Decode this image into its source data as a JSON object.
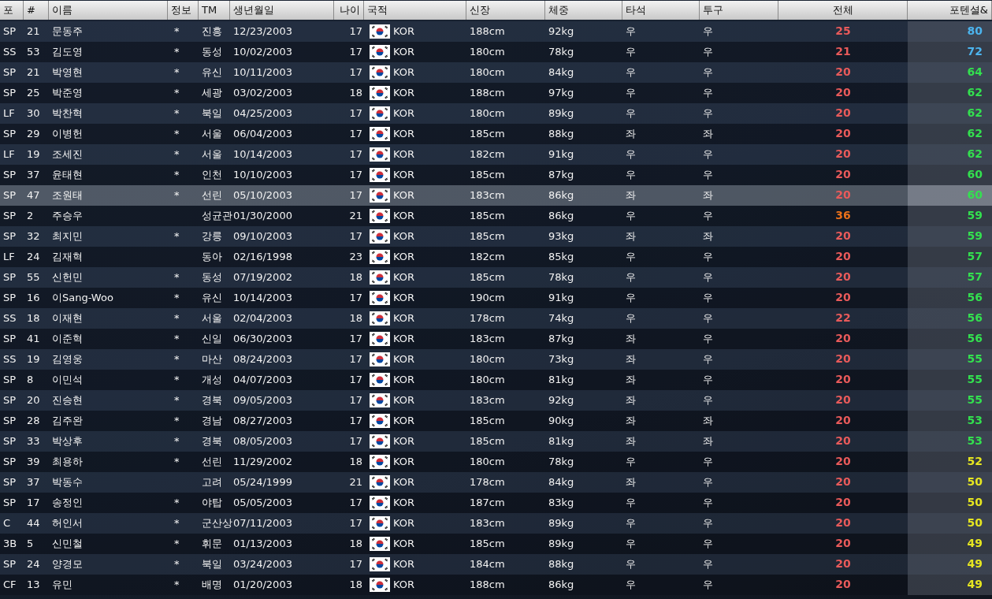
{
  "columns": [
    "포",
    "#",
    "이름",
    "정보",
    "TM",
    "생년월일",
    "나이",
    "국적",
    "신장",
    "체중",
    "타석",
    "투구",
    "전체",
    "포텐셜&"
  ],
  "rows": [
    {
      "pos": "SP",
      "no": "21",
      "name": "문동주",
      "info": "*",
      "tm": "진흥",
      "birth": "12/23/2003",
      "age": "17",
      "nation": "KOR",
      "height": "188cm",
      "weight": "92kg",
      "bat": "우",
      "throw": "우",
      "overall": {
        "value": "25",
        "color": "#e85a5a"
      },
      "potential": {
        "value": "80",
        "color": "#4cb4ee"
      },
      "selected": false
    },
    {
      "pos": "SS",
      "no": "53",
      "name": "김도영",
      "info": "*",
      "tm": "동성",
      "birth": "10/02/2003",
      "age": "17",
      "nation": "KOR",
      "height": "180cm",
      "weight": "78kg",
      "bat": "우",
      "throw": "우",
      "overall": {
        "value": "21",
        "color": "#e85a5a"
      },
      "potential": {
        "value": "72",
        "color": "#4cb4ee"
      },
      "selected": false
    },
    {
      "pos": "SP",
      "no": "21",
      "name": "박영현",
      "info": "*",
      "tm": "유신",
      "birth": "10/11/2003",
      "age": "17",
      "nation": "KOR",
      "height": "180cm",
      "weight": "84kg",
      "bat": "우",
      "throw": "우",
      "overall": {
        "value": "20",
        "color": "#e85a5a"
      },
      "potential": {
        "value": "64",
        "color": "#33e04f"
      },
      "selected": false
    },
    {
      "pos": "SP",
      "no": "25",
      "name": "박준영",
      "info": "*",
      "tm": "세광",
      "birth": "03/02/2003",
      "age": "18",
      "nation": "KOR",
      "height": "188cm",
      "weight": "97kg",
      "bat": "우",
      "throw": "우",
      "overall": {
        "value": "20",
        "color": "#e85a5a"
      },
      "potential": {
        "value": "62",
        "color": "#33e04f"
      },
      "selected": false
    },
    {
      "pos": "LF",
      "no": "30",
      "name": "박찬혁",
      "info": "*",
      "tm": "북일",
      "birth": "04/25/2003",
      "age": "17",
      "nation": "KOR",
      "height": "180cm",
      "weight": "89kg",
      "bat": "우",
      "throw": "우",
      "overall": {
        "value": "20",
        "color": "#e85a5a"
      },
      "potential": {
        "value": "62",
        "color": "#33e04f"
      },
      "selected": false
    },
    {
      "pos": "SP",
      "no": "29",
      "name": "이병헌",
      "info": "*",
      "tm": "서울",
      "birth": "06/04/2003",
      "age": "17",
      "nation": "KOR",
      "height": "185cm",
      "weight": "88kg",
      "bat": "좌",
      "throw": "좌",
      "overall": {
        "value": "20",
        "color": "#e85a5a"
      },
      "potential": {
        "value": "62",
        "color": "#33e04f"
      },
      "selected": false
    },
    {
      "pos": "LF",
      "no": "19",
      "name": "조세진",
      "info": "*",
      "tm": "서울",
      "birth": "10/14/2003",
      "age": "17",
      "nation": "KOR",
      "height": "182cm",
      "weight": "91kg",
      "bat": "우",
      "throw": "우",
      "overall": {
        "value": "20",
        "color": "#e85a5a"
      },
      "potential": {
        "value": "62",
        "color": "#33e04f"
      },
      "selected": false
    },
    {
      "pos": "SP",
      "no": "37",
      "name": "윤태현",
      "info": "*",
      "tm": "인천",
      "birth": "10/10/2003",
      "age": "17",
      "nation": "KOR",
      "height": "185cm",
      "weight": "87kg",
      "bat": "우",
      "throw": "우",
      "overall": {
        "value": "20",
        "color": "#e85a5a"
      },
      "potential": {
        "value": "60",
        "color": "#33e04f"
      },
      "selected": false
    },
    {
      "pos": "SP",
      "no": "47",
      "name": "조원태",
      "info": "*",
      "tm": "선린",
      "birth": "05/10/2003",
      "age": "17",
      "nation": "KOR",
      "height": "183cm",
      "weight": "86kg",
      "bat": "좌",
      "throw": "좌",
      "overall": {
        "value": "20",
        "color": "#e85a5a"
      },
      "potential": {
        "value": "60",
        "color": "#33e04f"
      },
      "selected": true
    },
    {
      "pos": "SP",
      "no": "2",
      "name": "주승우",
      "tm": "성균관",
      "birth": "01/30/2000",
      "age": "21",
      "nation": "KOR",
      "height": "185cm",
      "weight": "86kg",
      "bat": "우",
      "throw": "우",
      "overall": {
        "value": "36",
        "color": "#e8701a"
      },
      "potential": {
        "value": "59",
        "color": "#33e04f"
      },
      "selected": false
    },
    {
      "pos": "SP",
      "no": "32",
      "name": "최지민",
      "info": "*",
      "tm": "강릉",
      "birth": "09/10/2003",
      "age": "17",
      "nation": "KOR",
      "height": "185cm",
      "weight": "93kg",
      "bat": "좌",
      "throw": "좌",
      "overall": {
        "value": "20",
        "color": "#e85a5a"
      },
      "potential": {
        "value": "59",
        "color": "#33e04f"
      },
      "selected": false
    },
    {
      "pos": "LF",
      "no": "24",
      "name": "김재혁",
      "tm": "동아",
      "birth": "02/16/1998",
      "age": "23",
      "nation": "KOR",
      "height": "182cm",
      "weight": "85kg",
      "bat": "우",
      "throw": "우",
      "overall": {
        "value": "20",
        "color": "#e85a5a"
      },
      "potential": {
        "value": "57",
        "color": "#33e04f"
      },
      "selected": false
    },
    {
      "pos": "SP",
      "no": "55",
      "name": "신헌민",
      "info": "*",
      "tm": "동성",
      "birth": "07/19/2002",
      "age": "18",
      "nation": "KOR",
      "height": "185cm",
      "weight": "78kg",
      "bat": "우",
      "throw": "우",
      "overall": {
        "value": "20",
        "color": "#e85a5a"
      },
      "potential": {
        "value": "57",
        "color": "#33e04f"
      },
      "selected": false
    },
    {
      "pos": "SP",
      "no": "16",
      "name": "이Sang-Woo",
      "info": "*",
      "tm": "유신",
      "birth": "10/14/2003",
      "age": "17",
      "nation": "KOR",
      "height": "190cm",
      "weight": "91kg",
      "bat": "우",
      "throw": "우",
      "overall": {
        "value": "20",
        "color": "#e85a5a"
      },
      "potential": {
        "value": "56",
        "color": "#33e04f"
      },
      "selected": false
    },
    {
      "pos": "SS",
      "no": "18",
      "name": "이재현",
      "info": "*",
      "tm": "서울",
      "birth": "02/04/2003",
      "age": "18",
      "nation": "KOR",
      "height": "178cm",
      "weight": "74kg",
      "bat": "우",
      "throw": "우",
      "overall": {
        "value": "22",
        "color": "#e85a5a"
      },
      "potential": {
        "value": "56",
        "color": "#33e04f"
      },
      "selected": false
    },
    {
      "pos": "SP",
      "no": "41",
      "name": "이준혁",
      "info": "*",
      "tm": "신일",
      "birth": "06/30/2003",
      "age": "17",
      "nation": "KOR",
      "height": "183cm",
      "weight": "87kg",
      "bat": "좌",
      "throw": "우",
      "overall": {
        "value": "20",
        "color": "#e85a5a"
      },
      "potential": {
        "value": "56",
        "color": "#33e04f"
      },
      "selected": false
    },
    {
      "pos": "SS",
      "no": "19",
      "name": "김영웅",
      "info": "*",
      "tm": "마산",
      "birth": "08/24/2003",
      "age": "17",
      "nation": "KOR",
      "height": "180cm",
      "weight": "73kg",
      "bat": "좌",
      "throw": "우",
      "overall": {
        "value": "20",
        "color": "#e85a5a"
      },
      "potential": {
        "value": "55",
        "color": "#33e04f"
      },
      "selected": false
    },
    {
      "pos": "SP",
      "no": "8",
      "name": "이민석",
      "info": "*",
      "tm": "개성",
      "birth": "04/07/2003",
      "age": "17",
      "nation": "KOR",
      "height": "180cm",
      "weight": "81kg",
      "bat": "좌",
      "throw": "우",
      "overall": {
        "value": "20",
        "color": "#e85a5a"
      },
      "potential": {
        "value": "55",
        "color": "#33e04f"
      },
      "selected": false
    },
    {
      "pos": "SP",
      "no": "20",
      "name": "진승현",
      "info": "*",
      "tm": "경북",
      "birth": "09/05/2003",
      "age": "17",
      "nation": "KOR",
      "height": "183cm",
      "weight": "92kg",
      "bat": "좌",
      "throw": "우",
      "overall": {
        "value": "20",
        "color": "#e85a5a"
      },
      "potential": {
        "value": "55",
        "color": "#33e04f"
      },
      "selected": false
    },
    {
      "pos": "SP",
      "no": "28",
      "name": "김주완",
      "info": "*",
      "tm": "경남",
      "birth": "08/27/2003",
      "age": "17",
      "nation": "KOR",
      "height": "185cm",
      "weight": "90kg",
      "bat": "좌",
      "throw": "좌",
      "overall": {
        "value": "20",
        "color": "#e85a5a"
      },
      "potential": {
        "value": "53",
        "color": "#33e04f"
      },
      "selected": false
    },
    {
      "pos": "SP",
      "no": "33",
      "name": "박상후",
      "info": "*",
      "tm": "경북",
      "birth": "08/05/2003",
      "age": "17",
      "nation": "KOR",
      "height": "185cm",
      "weight": "81kg",
      "bat": "좌",
      "throw": "좌",
      "overall": {
        "value": "20",
        "color": "#e85a5a"
      },
      "potential": {
        "value": "53",
        "color": "#33e04f"
      },
      "selected": false
    },
    {
      "pos": "SP",
      "no": "39",
      "name": "최용하",
      "info": "*",
      "tm": "선린",
      "birth": "11/29/2002",
      "age": "18",
      "nation": "KOR",
      "height": "180cm",
      "weight": "78kg",
      "bat": "우",
      "throw": "우",
      "overall": {
        "value": "20",
        "color": "#e85a5a"
      },
      "potential": {
        "value": "52",
        "color": "#e6e620"
      },
      "selected": false
    },
    {
      "pos": "SP",
      "no": "37",
      "name": "박동수",
      "tm": "고려",
      "birth": "05/24/1999",
      "age": "21",
      "nation": "KOR",
      "height": "178cm",
      "weight": "84kg",
      "bat": "좌",
      "throw": "우",
      "overall": {
        "value": "20",
        "color": "#e85a5a"
      },
      "potential": {
        "value": "50",
        "color": "#e6e620"
      },
      "selected": false
    },
    {
      "pos": "SP",
      "no": "17",
      "name": "송정인",
      "info": "*",
      "tm": "야탑",
      "birth": "05/05/2003",
      "age": "17",
      "nation": "KOR",
      "height": "187cm",
      "weight": "83kg",
      "bat": "우",
      "throw": "우",
      "overall": {
        "value": "20",
        "color": "#e85a5a"
      },
      "potential": {
        "value": "50",
        "color": "#e6e620"
      },
      "selected": false
    },
    {
      "pos": "C",
      "no": "44",
      "name": "허인서",
      "info": "*",
      "tm": "군산상",
      "birth": "07/11/2003",
      "age": "17",
      "nation": "KOR",
      "height": "183cm",
      "weight": "89kg",
      "bat": "우",
      "throw": "우",
      "overall": {
        "value": "20",
        "color": "#e85a5a"
      },
      "potential": {
        "value": "50",
        "color": "#e6e620"
      },
      "selected": false
    },
    {
      "pos": "3B",
      "no": "5",
      "name": "신민철",
      "info": "*",
      "tm": "휘문",
      "birth": "01/13/2003",
      "age": "18",
      "nation": "KOR",
      "height": "185cm",
      "weight": "89kg",
      "bat": "우",
      "throw": "우",
      "overall": {
        "value": "20",
        "color": "#e85a5a"
      },
      "potential": {
        "value": "49",
        "color": "#e6e620"
      },
      "selected": false
    },
    {
      "pos": "SP",
      "no": "24",
      "name": "양경모",
      "info": "*",
      "tm": "북일",
      "birth": "03/24/2003",
      "age": "17",
      "nation": "KOR",
      "height": "184cm",
      "weight": "88kg",
      "bat": "우",
      "throw": "우",
      "overall": {
        "value": "20",
        "color": "#e85a5a"
      },
      "potential": {
        "value": "49",
        "color": "#e6e620"
      },
      "selected": false
    },
    {
      "pos": "CF",
      "no": "13",
      "name": "유민",
      "info": "*",
      "tm": "배명",
      "birth": "01/20/2003",
      "age": "18",
      "nation": "KOR",
      "height": "188cm",
      "weight": "86kg",
      "bat": "우",
      "throw": "우",
      "overall": {
        "value": "20",
        "color": "#e85a5a"
      },
      "potential": {
        "value": "49",
        "color": "#e6e620"
      },
      "selected": false
    }
  ]
}
